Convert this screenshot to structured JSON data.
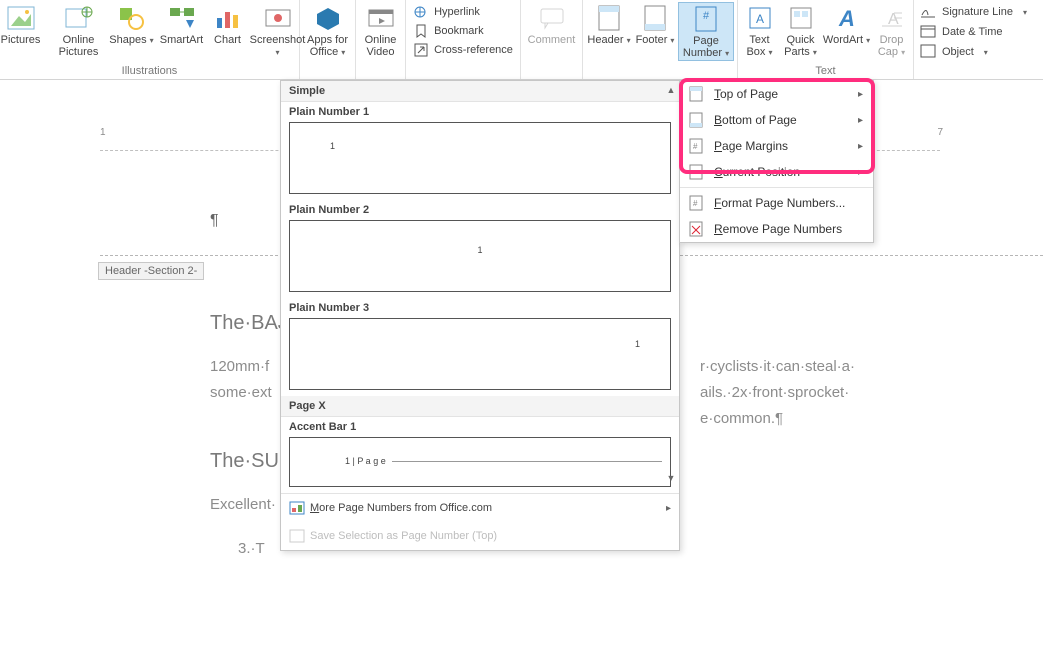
{
  "ribbon": {
    "pictures": "Pictures",
    "online_pictures": "Online Pictures",
    "shapes": "Shapes",
    "smartart": "SmartArt",
    "chart": "Chart",
    "screenshot": "Screenshot",
    "illustrations_label": "Illustrations",
    "apps": "Apps for Office",
    "online_video": "Online Video",
    "hyperlink": "Hyperlink",
    "bookmark": "Bookmark",
    "crossref": "Cross-reference",
    "comment": "Comment",
    "header": "Header",
    "footer": "Footer",
    "page_number": "Page Number",
    "text_box": "Text Box",
    "quick_parts": "Quick Parts",
    "wordart": "WordArt",
    "drop_cap": "Drop Cap",
    "signature": "Signature Line",
    "datetime": "Date & Time",
    "object": "Object",
    "text_label": "Text"
  },
  "ruler": [
    "1",
    "",
    "",
    "",
    "",
    "",
    "",
    "7"
  ],
  "doc": {
    "pilcrow": "¶",
    "header_tag": "Header -Section 2-",
    "h1a": "The·BAJ",
    "para1a": "120mm·f",
    "para1b": "r·cyclists·it·can·steal·a·",
    "para2a": "some·ext",
    "para2b": "ails.·2x·front·sprocket·",
    "para3b": "e·common.¶",
    "h1b": "The·SUM",
    "para4": "Excellent·",
    "para5": "3.·T"
  },
  "gallery": {
    "sec1": "Simple",
    "item1": "Plain Number 1",
    "item2": "Plain Number 2",
    "item3": "Plain Number 3",
    "sec2": "Page X",
    "item4": "Accent Bar 1",
    "prev_num": "1",
    "prev_accent": "1 | P a g e",
    "footer1": "More Page Numbers from Office.com",
    "footer2": "Save Selection as Page Number (Top)"
  },
  "menu2": {
    "top": "Top of Page",
    "bottom": "Bottom of Page",
    "margins": "Page Margins",
    "current": "Current Position",
    "format": "Format Page Numbers...",
    "remove": "Remove Page Numbers"
  }
}
